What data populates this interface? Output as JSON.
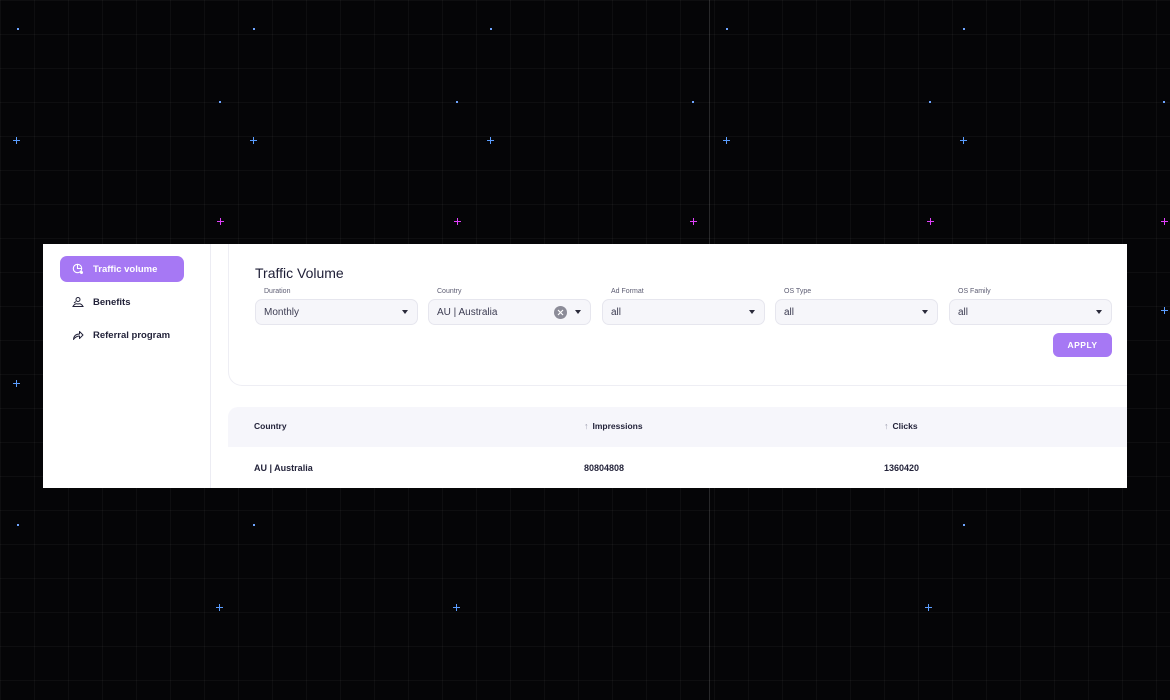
{
  "sidebar": {
    "items": [
      {
        "label": "Traffic volume",
        "icon": "traffic-icon",
        "active": true
      },
      {
        "label": "Benefits",
        "icon": "benefits-icon",
        "active": false
      },
      {
        "label": "Referral program",
        "icon": "share-icon",
        "active": false
      }
    ]
  },
  "page": {
    "title": "Traffic Volume"
  },
  "filters": {
    "duration": {
      "label": "Duration",
      "value": "Monthly"
    },
    "country": {
      "label": "Country",
      "value": "AU | Australia"
    },
    "ad_format": {
      "label": "Ad Format",
      "value": "all"
    },
    "os_type": {
      "label": "OS Type",
      "value": "all"
    },
    "os_family": {
      "label": "OS Family",
      "value": "all"
    },
    "apply_label": "APPLY"
  },
  "table": {
    "columns": [
      "Country",
      "Impressions",
      "Clicks"
    ],
    "rows": [
      {
        "country": "AU | Australia",
        "impressions": "80804808",
        "clicks": "1360420"
      }
    ]
  },
  "colors": {
    "accent": "#a678f4",
    "highlight": "#e81bd8",
    "background": "#050507"
  }
}
